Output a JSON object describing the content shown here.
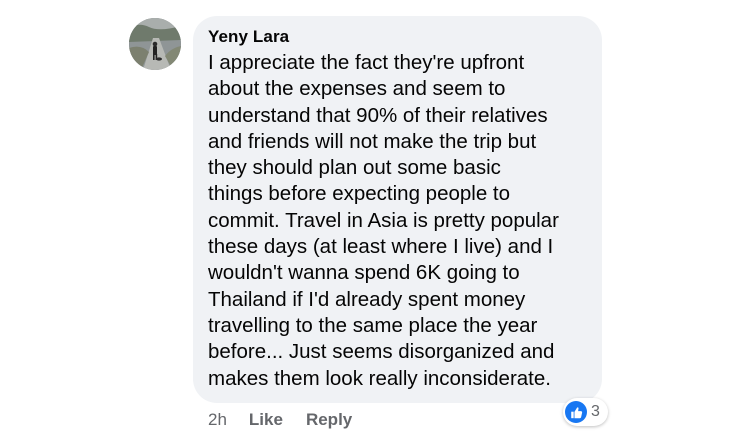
{
  "comment": {
    "author": "Yeny Lara",
    "lines": [
      "I appreciate the fact they're upfront",
      "about the expenses and seem to",
      "understand that 90% of their relatives",
      "and friends will not make the trip but",
      "they should plan out some basic",
      "things before expecting people to",
      "commit. Travel in Asia is pretty popular",
      "these days (at least where I live) and I",
      "wouldn't wanna spend 6K going to",
      "Thailand if I'd already spent money",
      "travelling to the same place the year",
      "before... Just seems disorganized and",
      "makes them look really inconsiderate."
    ],
    "time": "2h",
    "like_label": "Like",
    "reply_label": "Reply",
    "reaction_icon": "thumbs-up-icon",
    "reaction_count": "3",
    "colors": {
      "bubble": "#f0f2f5",
      "text": "#050505",
      "secondary": "#65676b",
      "like_blue": "#1877f2"
    }
  }
}
